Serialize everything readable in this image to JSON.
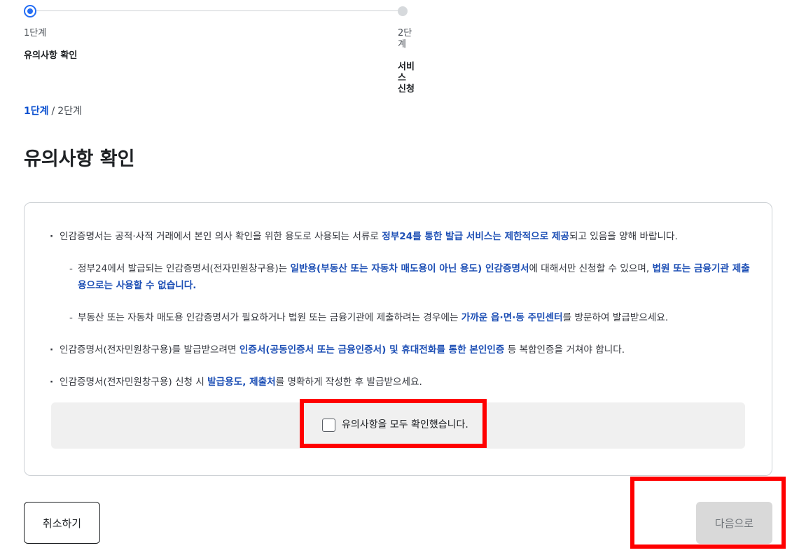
{
  "stepper": {
    "steps": [
      {
        "number": "1단계",
        "title": "유의사항 확인"
      },
      {
        "number": "2단계",
        "title": "서비스 신청"
      }
    ]
  },
  "breadcrumb": {
    "current": "1단계",
    "separator": "/",
    "next": "2단계"
  },
  "page_title": "유의사항 확인",
  "notice": {
    "item1": {
      "pre": "인감증명서는 공적·사적 거래에서 본인 의사 확인을 위한 용도로 사용되는 서류로 ",
      "em": "정부24를 통한 발급 서비스는 제한적으로 제공",
      "post": "되고 있음을 양해 바랍니다."
    },
    "sub1": {
      "pre": "정부24에서 발급되는 인감증명서(전자민원창구용)는 ",
      "em1": "일반용(부동산 또는 자동차 매도용이 아닌 용도) 인감증명서",
      "mid": "에 대해서만 신청할 수 있으며, ",
      "em2": "법원 또는 금융기관 제출용으로는 사용할 수 없습니다."
    },
    "sub2": {
      "pre": "부동산 또는 자동차 매도용 인감증명서가 필요하거나 법원 또는 금융기관에 제출하려는 경우에는 ",
      "em": "가까운 읍·면·동 주민센터",
      "post": "를 방문하여 발급받으세요."
    },
    "item2": {
      "pre": "인감증명서(전자민원창구용)를 발급받으려면 ",
      "em": "인증서(공동인증서 또는 금융인증서) 및 휴대전화를 통한 본인인증",
      "post": " 등 복합인증을 거쳐야 합니다."
    },
    "item3": {
      "pre": "인감증명서(전자민원창구용) 신청 시 ",
      "em": "발급용도, 제출처",
      "post": "를 명확하게 작성한 후 발급받으세요."
    },
    "confirm_label": "유의사항을 모두 확인했습니다."
  },
  "buttons": {
    "cancel": "취소하기",
    "next": "다음으로"
  },
  "colors": {
    "accent": "#256ef4",
    "emphasis": "#1d4fb5",
    "highlight": "#ff0000"
  }
}
